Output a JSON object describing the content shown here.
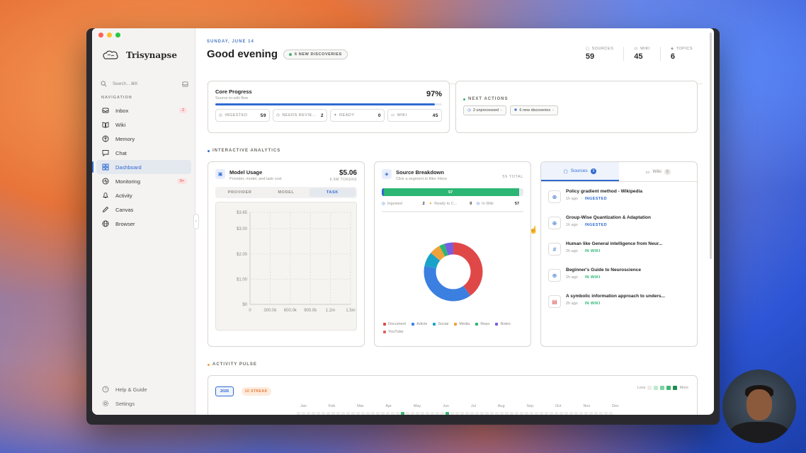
{
  "brand": {
    "name": "Trisynapse"
  },
  "search": {
    "placeholder": "Search... ⌘K"
  },
  "nav": {
    "title": "NAVIGATION",
    "items": [
      {
        "label": "Inbox",
        "badge": "2"
      },
      {
        "label": "Wiki"
      },
      {
        "label": "Memory"
      },
      {
        "label": "Chat"
      },
      {
        "label": "Dashboard",
        "active": true
      },
      {
        "label": "Monitoring",
        "badge": "9+"
      },
      {
        "label": "Activity"
      },
      {
        "label": "Canvas"
      },
      {
        "label": "Browser"
      }
    ],
    "bottom": [
      {
        "label": "Help & Guide"
      },
      {
        "label": "Settings"
      }
    ]
  },
  "header": {
    "date": "SUNDAY, JUNE 14",
    "greeting": "Good evening",
    "discoveries_pill": "6 NEW DISCOVERIES",
    "stats": [
      {
        "label": "SOURCES",
        "value": "59"
      },
      {
        "label": "WIKI",
        "value": "45"
      },
      {
        "label": "TOPICS",
        "value": "6"
      }
    ]
  },
  "core": {
    "title": "Core Progress",
    "subtitle": "Source-to-wiki flow",
    "percent": "97%",
    "progress": 0.97,
    "chips": [
      {
        "label": "INGESTED",
        "value": "59"
      },
      {
        "label": "NEEDS REVIE...",
        "value": "2"
      },
      {
        "label": "READY",
        "value": "0"
      },
      {
        "label": "WIKI",
        "value": "45"
      }
    ]
  },
  "next_actions": {
    "title": "NEXT ACTIONS",
    "chips": [
      {
        "label": "2 unprocessed"
      },
      {
        "label": "6 new discoveries"
      }
    ]
  },
  "analytics": {
    "title": "INTERACTIVE ANALYTICS"
  },
  "usage": {
    "title": "Model Usage",
    "subtitle": "Provider, model, and task cost",
    "cost": "$5.06",
    "tokens": "6.6M TOKENS",
    "tabs": [
      "PROVIDER",
      "MODEL",
      "TASK"
    ],
    "active_tab": "TASK"
  },
  "chart_data": {
    "type": "bar",
    "title": "",
    "x_ticks": [
      "0",
      "300.0k",
      "600.0k",
      "900.0k",
      "1.2m",
      "1.5m"
    ],
    "y_ticks": [
      "$0",
      "$1.00",
      "$2.00",
      "$3.00",
      "$3.65"
    ],
    "xlim": [
      0,
      1500000
    ],
    "ylim": [
      0,
      3.65
    ],
    "grid": true,
    "categories": [],
    "values": []
  },
  "breakdown": {
    "title": "Source Breakdown",
    "subtitle": "Click a segment to filter Inbox",
    "total": "59 TOTAL",
    "bar_label": "57",
    "bar_fraction": 0.97,
    "stats": [
      {
        "label": "Ingested",
        "value": "2"
      },
      {
        "label": "Ready to C...",
        "value": "0"
      },
      {
        "label": "In Wiki",
        "value": "57"
      }
    ],
    "donut": [
      {
        "name": "Document",
        "value": 40,
        "color": "#e04848"
      },
      {
        "name": "Article",
        "value": 38,
        "color": "#3b7fe0"
      },
      {
        "name": "Social",
        "value": 8,
        "color": "#1aa3c9"
      },
      {
        "name": "Media",
        "value": 6,
        "color": "#f0a23a"
      },
      {
        "name": "Repo",
        "value": 3,
        "color": "#2bb673"
      },
      {
        "name": "Notes",
        "value": 5,
        "color": "#7a5ce0"
      }
    ],
    "legend": [
      {
        "label": "Document",
        "color": "#e04848"
      },
      {
        "label": "Article",
        "color": "#3b7fe0"
      },
      {
        "label": "Social",
        "color": "#1aa3c9"
      },
      {
        "label": "Media",
        "color": "#f0a23a"
      },
      {
        "label": "Repo",
        "color": "#2bb673"
      },
      {
        "label": "Notes",
        "color": "#7a5ce0"
      },
      {
        "label": "YouTube",
        "color": "#e06060"
      }
    ]
  },
  "sources": {
    "tabs": [
      {
        "label": "Sources",
        "count": "5"
      },
      {
        "label": "Wiki",
        "count": "5"
      }
    ],
    "items": [
      {
        "title": "Policy gradient method - Wikipedia",
        "time": "1h ago",
        "status": "INGESTED",
        "icon": "globe-icon"
      },
      {
        "title": "Group-Wise Quantization & Adaptation",
        "time": "1h ago",
        "status": "INGESTED",
        "icon": "globe-icon"
      },
      {
        "title": "Human like General intelligence from Neur...",
        "time": "2h ago",
        "status": "IN WIKI",
        "icon": "hash-icon"
      },
      {
        "title": "Beginner's Guide to Neuroscience",
        "time": "2h ago",
        "status": "IN WIKI",
        "icon": "globe-icon"
      },
      {
        "title": "A symbolic information approach to unders...",
        "time": "2h ago",
        "status": "IN WIKI",
        "icon": "document-icon"
      }
    ]
  },
  "pulse": {
    "title": "ACTIVITY PULSE",
    "year": "2026",
    "streak": "10 STREAK",
    "less": "Less",
    "more": "More",
    "months": [
      "Jan",
      "Feb",
      "Mar",
      "Apr",
      "May",
      "Jun",
      "Jul",
      "Aug",
      "Sep",
      "Oct",
      "Nov",
      "Dec"
    ]
  },
  "colors": {
    "accent": "#2f6bd1",
    "green": "#2bb673",
    "orange": "#e57a3c"
  }
}
